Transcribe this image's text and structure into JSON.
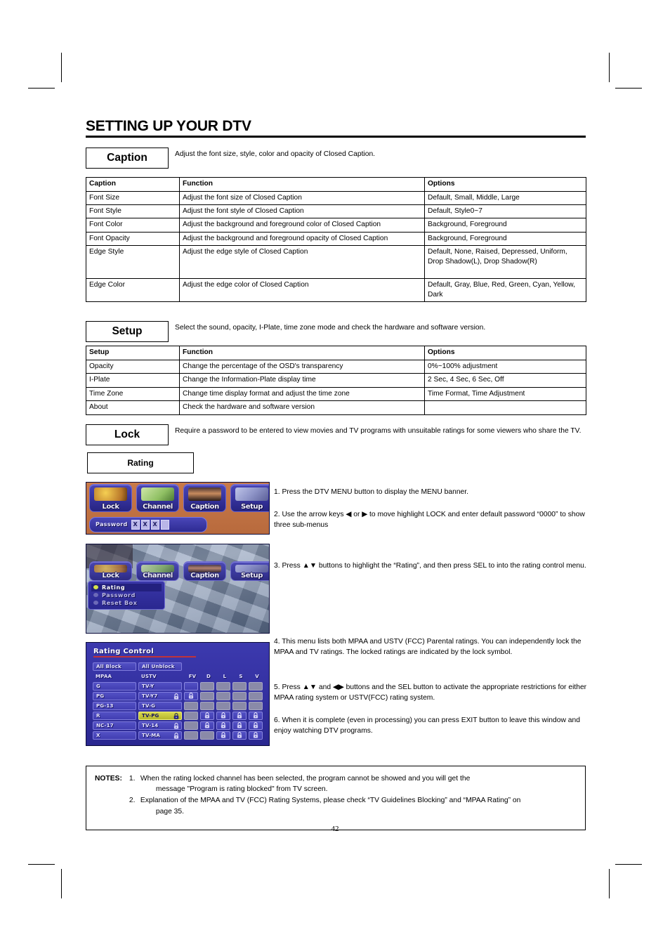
{
  "page": {
    "title": "SETTING UP YOUR DTV",
    "number": "42"
  },
  "caption_section": {
    "label": "Caption",
    "description": "Adjust the font size, style, color and opacity of Closed Caption.",
    "table": {
      "headers": [
        "Caption",
        "Function",
        "Options"
      ],
      "rows": [
        [
          "Font Size",
          "Adjust the font size of Closed Caption",
          "Default, Small, Middle, Large"
        ],
        [
          "Font Style",
          "Adjust the font style of Closed Caption",
          "Default, Style0~7"
        ],
        [
          "Font Color",
          "Adjust the background and foreground color of Closed Caption",
          "Background, Foreground"
        ],
        [
          "Font Opacity",
          "Adjust the background and foreground opacity of Closed Caption",
          "Background, Foreground"
        ],
        [
          "Edge Style",
          "Adjust the edge style of Closed Caption",
          "Default, None, Raised, Depressed, Uniform, Drop Shadow(L), Drop Shadow(R)"
        ],
        [
          "Edge Color",
          "Adjust the edge color of Closed Caption",
          "Default, Gray, Blue, Red, Green, Cyan, Yellow, Dark"
        ]
      ]
    }
  },
  "setup_section": {
    "label": "Setup",
    "description": "Select the sound, opacity, I-Plate, time zone mode and check the hardware and software version.",
    "table": {
      "headers": [
        "Setup",
        "Function",
        "Options"
      ],
      "rows": [
        [
          "Opacity",
          "Change the percentage of the OSD's transparency",
          "0%~100% adjustment"
        ],
        [
          "I-Plate",
          "Change the Information-Plate display time",
          "2 Sec, 4 Sec, 6 Sec, Off"
        ],
        [
          "Time Zone",
          "Change time display format and adjust the time zone",
          "Time Format, Time Adjustment"
        ],
        [
          "About",
          "Check the hardware and software version",
          ""
        ]
      ]
    }
  },
  "lock_section": {
    "label": "Lock",
    "description": "Require a password to be entered to view movies and TV programs with unsuitable ratings for some viewers who share the TV.",
    "rating_label": "Rating"
  },
  "steps": [
    "1. Press the DTV MENU button to display the MENU banner.",
    "2. Use the arrow keys ◀ or ▶ to move highlight LOCK and enter default password “0000” to show three sub-menus",
    "3. Press ▲▼ buttons to highlight the “Rating”, and then press SEL to into the rating control menu.",
    "4. This menu lists both MPAA and USTV (FCC) Parental ratings. You can independently lock the MPAA and TV ratings. The locked ratings are indicated by the lock symbol.",
    "5. Press ▲▼ and ◀▶ buttons and the SEL button to activate the appropriate restrictions for either MPAA rating system or USTV(FCC) rating system.",
    "6. When it is complete (even in processing) you can press EXIT button to leave this window and enjoy watching DTV programs."
  ],
  "osd_banner": {
    "tabs": [
      "Lock",
      "Channel",
      "Caption",
      "Setup"
    ],
    "password_label": "Password",
    "password_cells": [
      "X",
      "X",
      "X",
      ""
    ]
  },
  "osd_submenu": {
    "tabs": [
      "Lock",
      "Channel",
      "Caption",
      "Setup"
    ],
    "items": [
      "Rating",
      "Password",
      "Reset Box"
    ],
    "selected": "Rating"
  },
  "rating_control": {
    "title": "Rating Control",
    "all_block_label": "All Block",
    "all_unblock_label": "All Unblock",
    "col_mpaa_header": "MPAA",
    "col_ustv_header": "USTV",
    "content_headers": [
      "FV",
      "D",
      "L",
      "S",
      "V"
    ],
    "rows": [
      {
        "mpaa": "G",
        "ustv": "TV-Y",
        "ustv_locked": false,
        "flags": [
          false,
          false,
          false,
          false,
          false
        ],
        "flag_active": [
          true,
          false,
          false,
          false,
          false
        ],
        "highlighted": false
      },
      {
        "mpaa": "PG",
        "ustv": "TV-Y7",
        "ustv_locked": true,
        "flags": [
          true,
          false,
          false,
          false,
          false
        ],
        "flag_active": [
          true,
          false,
          false,
          false,
          false
        ],
        "highlighted": false
      },
      {
        "mpaa": "PG-13",
        "ustv": "TV-G",
        "ustv_locked": false,
        "flags": [
          false,
          false,
          false,
          false,
          false
        ],
        "flag_active": [
          false,
          false,
          false,
          false,
          false
        ],
        "highlighted": false
      },
      {
        "mpaa": "R",
        "ustv": "TV-PG",
        "ustv_locked": true,
        "flags": [
          false,
          true,
          true,
          true,
          true
        ],
        "flag_active": [
          false,
          true,
          true,
          true,
          true
        ],
        "highlighted": true
      },
      {
        "mpaa": "NC-17",
        "ustv": "TV-14",
        "ustv_locked": true,
        "flags": [
          false,
          true,
          true,
          true,
          true
        ],
        "flag_active": [
          false,
          true,
          true,
          true,
          true
        ],
        "highlighted": false
      },
      {
        "mpaa": "X",
        "ustv": "TV-MA",
        "ustv_locked": true,
        "flags": [
          false,
          false,
          true,
          true,
          true
        ],
        "flag_active": [
          false,
          false,
          true,
          true,
          true
        ],
        "highlighted": false
      }
    ]
  },
  "notes": {
    "label": "NOTES:",
    "items": [
      {
        "num": "1.",
        "lines": [
          "When the rating locked channel has been selected, the program cannot be showed and you will get the",
          "message \"Program is rating blocked\" from TV screen."
        ]
      },
      {
        "num": "2.",
        "lines": [
          "Explanation of the MPAA and TV (FCC) Rating Systems, please check “TV Guidelines Blocking” and “MPAA Rating” on",
          "page 35."
        ]
      }
    ]
  }
}
